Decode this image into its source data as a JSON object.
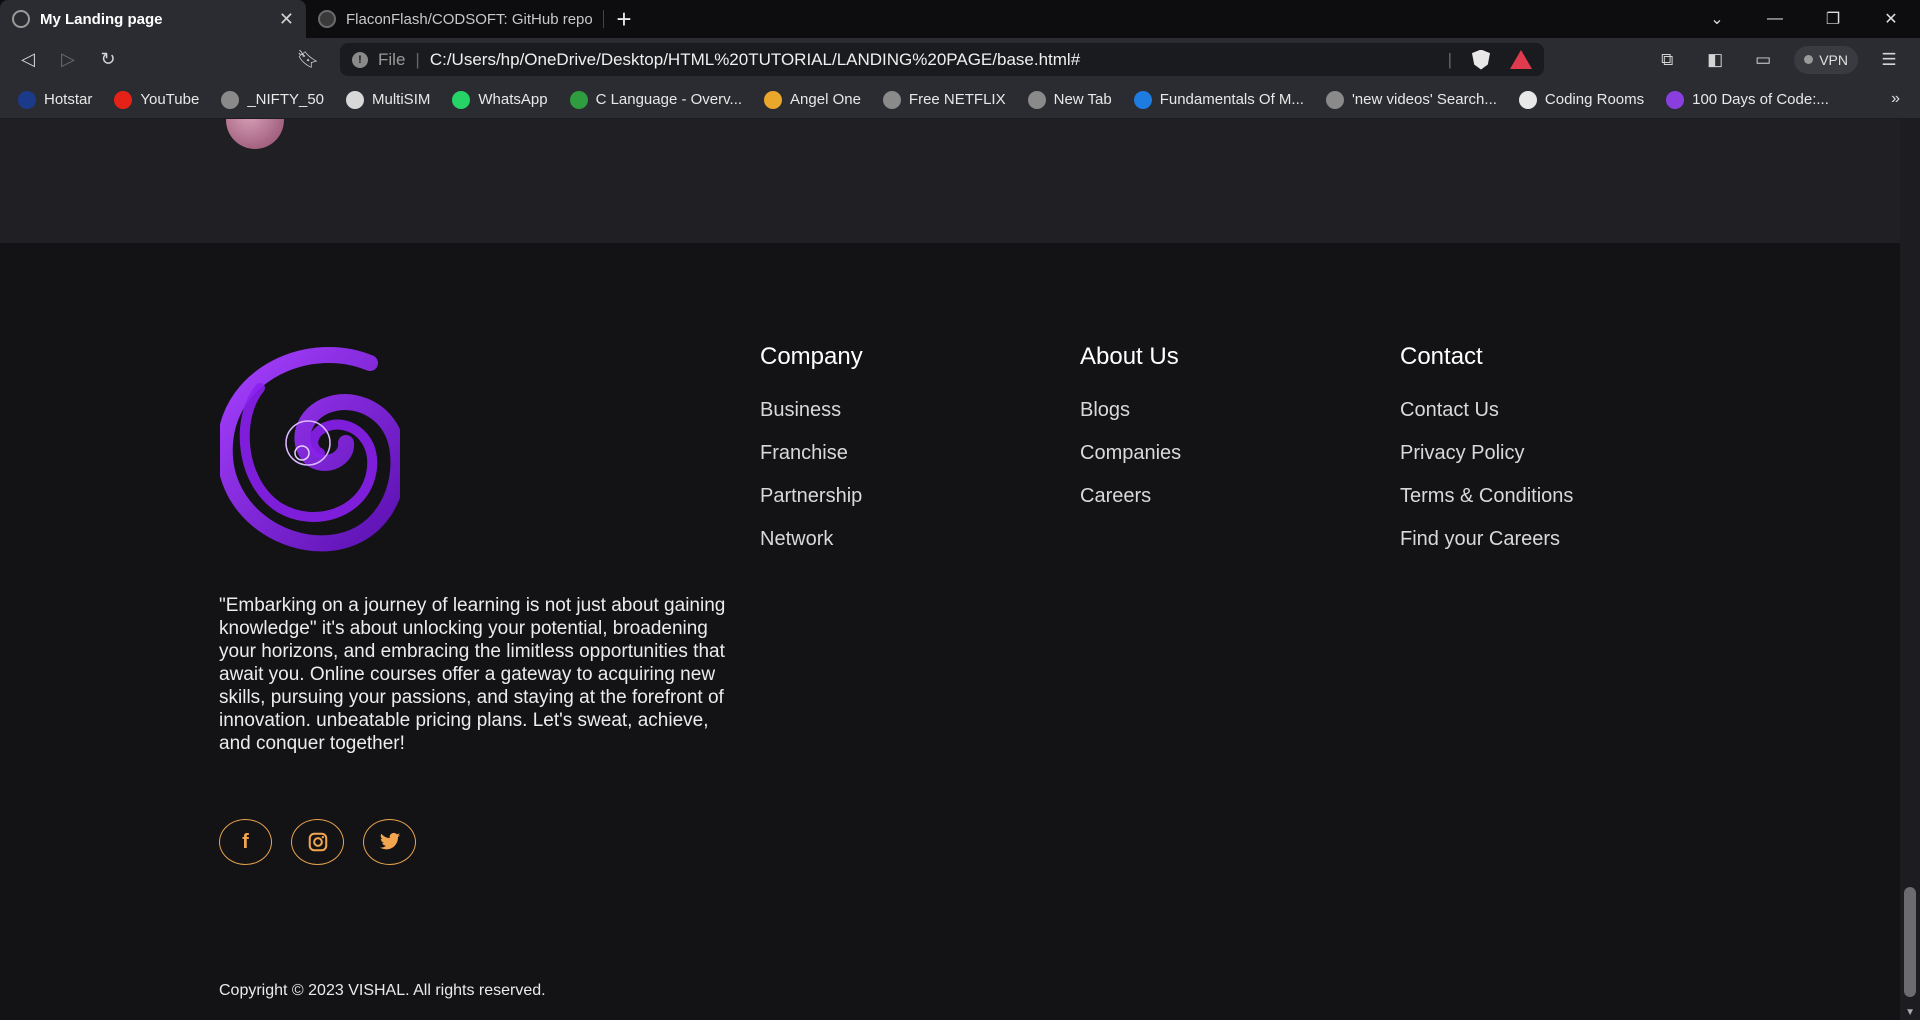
{
  "browser": {
    "tabs": [
      {
        "title": "My Landing page",
        "active": true,
        "close": "✕"
      },
      {
        "title": "FlaconFlash/CODSOFT: GitHub reposit",
        "active": false
      }
    ],
    "new_tab": "+",
    "url_scheme": "File",
    "url": "C:/Users/hp/OneDrive/Desktop/HTML%20TUTORIAL/LANDING%20PAGE/base.html#",
    "vpn_label": "VPN",
    "bookmarks": [
      {
        "label": "Hotstar",
        "color": "#1b3a8a"
      },
      {
        "label": "YouTube",
        "color": "#e62117"
      },
      {
        "label": "_NIFTY_50",
        "color": "#8a8a8a"
      },
      {
        "label": "MultiSIM",
        "color": "#d8d8d8"
      },
      {
        "label": "WhatsApp",
        "color": "#25d366"
      },
      {
        "label": "C Language - Overv...",
        "color": "#2e9c3f"
      },
      {
        "label": "Angel One",
        "color": "#e9a82b"
      },
      {
        "label": "Free NETFLIX",
        "color": "#8a8a8a"
      },
      {
        "label": "New Tab",
        "color": "#8a8a8a"
      },
      {
        "label": "Fundamentals Of M...",
        "color": "#1e7be0"
      },
      {
        "label": "'new videos' Search...",
        "color": "#8a8a8a"
      },
      {
        "label": "Coding Rooms",
        "color": "#e8e8e8"
      },
      {
        "label": "100 Days of Code:...",
        "color": "#8b3ee0"
      }
    ],
    "overflow": "»"
  },
  "footer": {
    "quote": "\"Embarking on a journey of learning is not just about gaining knowledge\" it's about unlocking your potential, broadening your horizons, and embracing the limitless opportunities that await you. Online courses offer a gateway to acquiring new skills, pursuing your passions, and staying at the forefront of innovation. unbeatable pricing plans. Let's sweat, achieve, and conquer together!",
    "socials": [
      {
        "name": "facebook",
        "glyph": "f"
      },
      {
        "name": "instagram",
        "glyph": "◎"
      },
      {
        "name": "twitter",
        "glyph": "🐦"
      }
    ],
    "columns": {
      "company": {
        "title": "Company",
        "links": [
          "Business",
          "Franchise",
          "Partnership",
          "Network"
        ]
      },
      "about": {
        "title": "About Us",
        "links": [
          "Blogs",
          "Companies",
          "Careers"
        ]
      },
      "contact": {
        "title": "Contact",
        "links": [
          "Contact Us",
          "Privacy Policy",
          "Terms & Conditions",
          "Find your Careers"
        ]
      }
    },
    "copyright": "Copyright © 2023 VISHAL. All rights reserved."
  },
  "colors": {
    "accent_social": "#e7a24e",
    "logo_purple": "#7a1bd9",
    "page_bg": "#131316"
  }
}
